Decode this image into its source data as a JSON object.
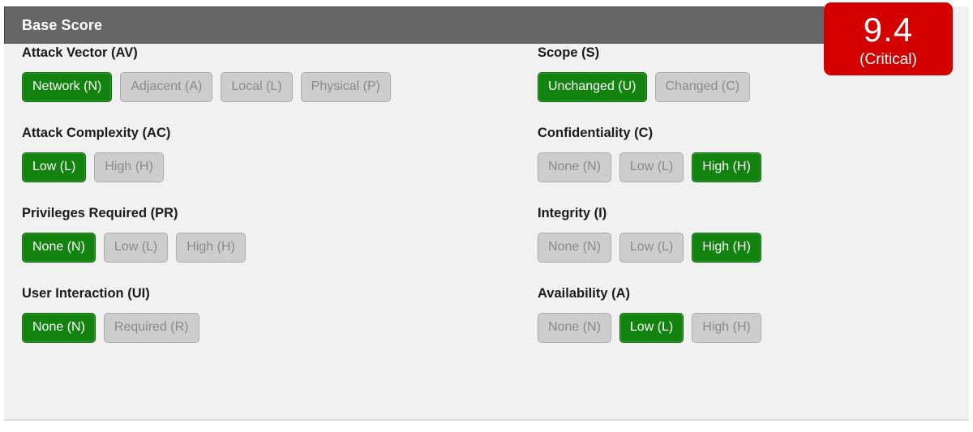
{
  "panel": {
    "title": "Base Score"
  },
  "score": {
    "value": "9.4",
    "severity": "(Critical)",
    "color": "#d40000"
  },
  "colors": {
    "header_bg": "#666666",
    "body_bg": "#f1f1f1",
    "selected_bg": "#13830f",
    "unselected_bg": "#cdcdcd",
    "unselected_text": "#8a8a8a"
  },
  "columns": [
    {
      "name": "left",
      "groups": [
        {
          "key": "attack-vector",
          "label": "Attack Vector (AV)",
          "options": [
            {
              "label": "Network (N)",
              "selected": true
            },
            {
              "label": "Adjacent (A)",
              "selected": false
            },
            {
              "label": "Local (L)",
              "selected": false
            },
            {
              "label": "Physical (P)",
              "selected": false
            }
          ]
        },
        {
          "key": "attack-complexity",
          "label": "Attack Complexity (AC)",
          "options": [
            {
              "label": "Low (L)",
              "selected": true
            },
            {
              "label": "High (H)",
              "selected": false
            }
          ]
        },
        {
          "key": "privileges-required",
          "label": "Privileges Required (PR)",
          "options": [
            {
              "label": "None (N)",
              "selected": true
            },
            {
              "label": "Low (L)",
              "selected": false
            },
            {
              "label": "High (H)",
              "selected": false
            }
          ]
        },
        {
          "key": "user-interaction",
          "label": "User Interaction (UI)",
          "options": [
            {
              "label": "None (N)",
              "selected": true
            },
            {
              "label": "Required (R)",
              "selected": false
            }
          ]
        }
      ]
    },
    {
      "name": "right",
      "groups": [
        {
          "key": "scope",
          "label": "Scope (S)",
          "options": [
            {
              "label": "Unchanged (U)",
              "selected": true
            },
            {
              "label": "Changed (C)",
              "selected": false
            }
          ]
        },
        {
          "key": "confidentiality",
          "label": "Confidentiality (C)",
          "options": [
            {
              "label": "None (N)",
              "selected": false
            },
            {
              "label": "Low (L)",
              "selected": false
            },
            {
              "label": "High (H)",
              "selected": true
            }
          ]
        },
        {
          "key": "integrity",
          "label": "Integrity (I)",
          "options": [
            {
              "label": "None (N)",
              "selected": false
            },
            {
              "label": "Low (L)",
              "selected": false
            },
            {
              "label": "High (H)",
              "selected": true
            }
          ]
        },
        {
          "key": "availability",
          "label": "Availability (A)",
          "options": [
            {
              "label": "None (N)",
              "selected": false
            },
            {
              "label": "Low (L)",
              "selected": true
            },
            {
              "label": "High (H)",
              "selected": false
            }
          ]
        }
      ]
    }
  ]
}
